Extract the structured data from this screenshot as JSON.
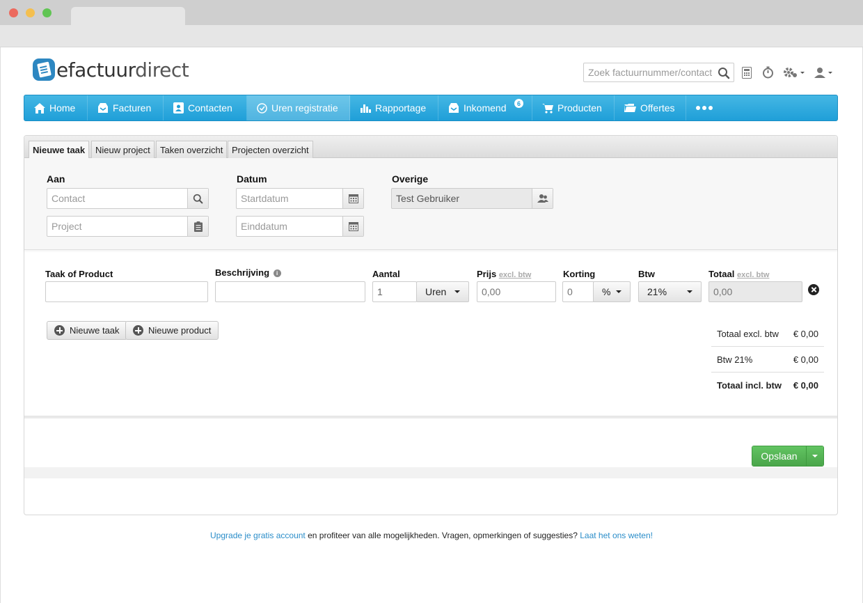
{
  "header": {
    "logo_part1": "efactuur",
    "logo_part2": "direct",
    "search_placeholder": "Zoek factuurnummer/contact"
  },
  "nav": {
    "items": [
      {
        "label": "Home",
        "icon": "home-icon"
      },
      {
        "label": "Facturen",
        "icon": "inbox-icon"
      },
      {
        "label": "Contacten",
        "icon": "contact-card-icon"
      },
      {
        "label": "Uren registratie",
        "icon": "clock-icon",
        "active": true
      },
      {
        "label": "Rapportage",
        "icon": "bar-chart-icon"
      },
      {
        "label": "Inkomend",
        "icon": "inbox-icon",
        "badge": "6"
      },
      {
        "label": "Producten",
        "icon": "cart-icon"
      },
      {
        "label": "Offertes",
        "icon": "folder-icon"
      }
    ]
  },
  "tabs": [
    "Nieuwe taak",
    "Nieuw project",
    "Taken overzicht",
    "Projecten overzicht"
  ],
  "form": {
    "aan_label": "Aan",
    "contact_placeholder": "Contact",
    "project_placeholder": "Project",
    "datum_label": "Datum",
    "startdatum_placeholder": "Startdatum",
    "einddatum_placeholder": "Einddatum",
    "overige_label": "Overige",
    "user_value": "Test Gebruiker"
  },
  "line": {
    "taak_label": "Taak of Product",
    "beschrijving_label": "Beschrijving",
    "aantal_label": "Aantal",
    "aantal_value": "1",
    "unit": "Uren",
    "prijs_label": "Prijs",
    "excl_btw": "excl. btw",
    "prijs_placeholder": "0,00",
    "korting_label": "Korting",
    "korting_placeholder": "0",
    "korting_unit": "%",
    "btw_label": "Btw",
    "btw_value": "21%",
    "totaal_label": "Totaal",
    "totaal_value": "0,00"
  },
  "buttons": {
    "nieuwe_taak": "Nieuwe taak",
    "nieuwe_product": "Nieuwe product",
    "opslaan": "Opslaan"
  },
  "totals": [
    {
      "label": "Totaal excl. btw",
      "value": "€ 0,00"
    },
    {
      "label": "Btw 21%",
      "value": "€ 0,00"
    },
    {
      "label": "Totaal incl. btw",
      "value": "€ 0,00"
    }
  ],
  "footer": {
    "link1": "Upgrade je gratis account",
    "text1": " en profiteer van alle mogelijkheden. Vragen, opmerkingen of suggesties? ",
    "link2": "Laat het ons weten!"
  },
  "colors": {
    "nav_blue": "#1f9fd8",
    "save_green": "#4aa54a",
    "link_blue": "#2a8dc9"
  }
}
